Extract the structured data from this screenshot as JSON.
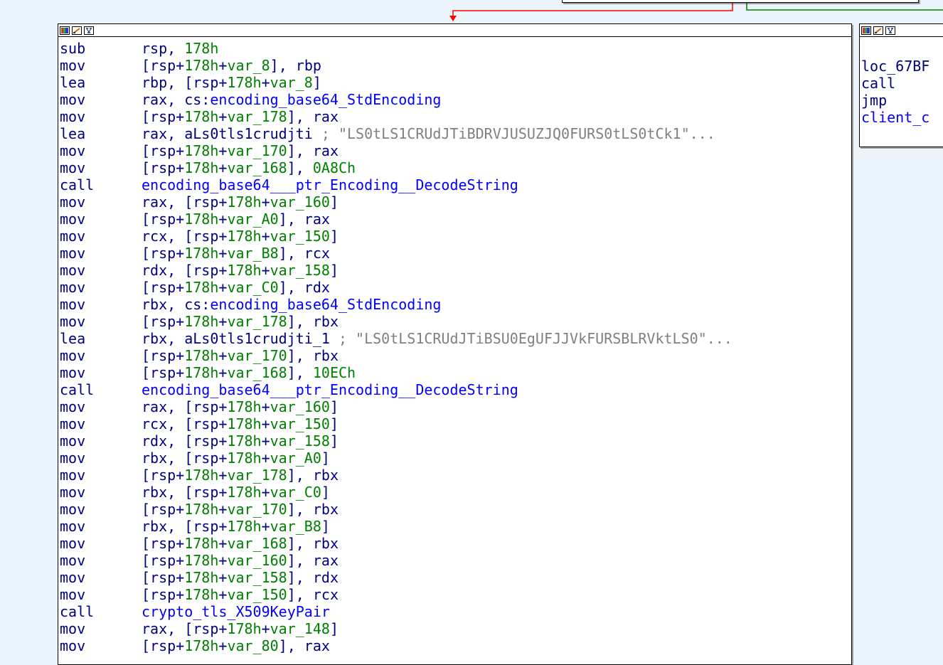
{
  "colors": {
    "background": "#ebf4fb",
    "mnemonic": "#000080",
    "register": "#000080",
    "variable": "#008000",
    "function": "#0000ff",
    "comment": "#808080",
    "edge_taken": "#ff0000",
    "edge_fallthrough": "#008000"
  },
  "main_node": {
    "title_icons": [
      "color-palette-icon",
      "edit-node-icon",
      "graph-overview-icon"
    ],
    "lines": [
      {
        "m": "sub",
        "o": [
          {
            "t": "rsp, ",
            "c": "reg"
          },
          {
            "t": "178h",
            "c": "num"
          }
        ]
      },
      {
        "m": "mov",
        "o": [
          {
            "t": "[rsp+",
            "c": "reg"
          },
          {
            "t": "178h",
            "c": "num"
          },
          {
            "t": "+",
            "c": "reg"
          },
          {
            "t": "var_8",
            "c": "var"
          },
          {
            "t": "], rbp",
            "c": "reg"
          }
        ]
      },
      {
        "m": "lea",
        "o": [
          {
            "t": "rbp, [rsp+",
            "c": "reg"
          },
          {
            "t": "178h",
            "c": "num"
          },
          {
            "t": "+",
            "c": "reg"
          },
          {
            "t": "var_8",
            "c": "var"
          },
          {
            "t": "]",
            "c": "reg"
          }
        ]
      },
      {
        "m": "mov",
        "o": [
          {
            "t": "rax, cs:",
            "c": "reg"
          },
          {
            "t": "encoding_base64_StdEncoding",
            "c": "fn"
          }
        ]
      },
      {
        "m": "mov",
        "o": [
          {
            "t": "[rsp+",
            "c": "reg"
          },
          {
            "t": "178h",
            "c": "num"
          },
          {
            "t": "+",
            "c": "reg"
          },
          {
            "t": "var_178",
            "c": "var"
          },
          {
            "t": "], rax",
            "c": "reg"
          }
        ]
      },
      {
        "m": "lea",
        "o": [
          {
            "t": "rax, aLs0tls1crudjti ",
            "c": "reg"
          },
          {
            "t": "; \"LS0tLS1CRUdJTiBDRVJUSUZJQ0FURS0tLS0tCk1\"...",
            "c": "cmt"
          }
        ]
      },
      {
        "m": "mov",
        "o": [
          {
            "t": "[rsp+",
            "c": "reg"
          },
          {
            "t": "178h",
            "c": "num"
          },
          {
            "t": "+",
            "c": "reg"
          },
          {
            "t": "var_170",
            "c": "var"
          },
          {
            "t": "], rax",
            "c": "reg"
          }
        ]
      },
      {
        "m": "mov",
        "o": [
          {
            "t": "[rsp+",
            "c": "reg"
          },
          {
            "t": "178h",
            "c": "num"
          },
          {
            "t": "+",
            "c": "reg"
          },
          {
            "t": "var_168",
            "c": "var"
          },
          {
            "t": "], ",
            "c": "reg"
          },
          {
            "t": "0A8Ch",
            "c": "num"
          }
        ]
      },
      {
        "m": "call",
        "o": [
          {
            "t": "encoding_base64___ptr_Encoding__DecodeString",
            "c": "fn"
          }
        ]
      },
      {
        "m": "mov",
        "o": [
          {
            "t": "rax, [rsp+",
            "c": "reg"
          },
          {
            "t": "178h",
            "c": "num"
          },
          {
            "t": "+",
            "c": "reg"
          },
          {
            "t": "var_160",
            "c": "var"
          },
          {
            "t": "]",
            "c": "reg"
          }
        ]
      },
      {
        "m": "mov",
        "o": [
          {
            "t": "[rsp+",
            "c": "reg"
          },
          {
            "t": "178h",
            "c": "num"
          },
          {
            "t": "+",
            "c": "reg"
          },
          {
            "t": "var_A0",
            "c": "var"
          },
          {
            "t": "], rax",
            "c": "reg"
          }
        ]
      },
      {
        "m": "mov",
        "o": [
          {
            "t": "rcx, [rsp+",
            "c": "reg"
          },
          {
            "t": "178h",
            "c": "num"
          },
          {
            "t": "+",
            "c": "reg"
          },
          {
            "t": "var_150",
            "c": "var"
          },
          {
            "t": "]",
            "c": "reg"
          }
        ]
      },
      {
        "m": "mov",
        "o": [
          {
            "t": "[rsp+",
            "c": "reg"
          },
          {
            "t": "178h",
            "c": "num"
          },
          {
            "t": "+",
            "c": "reg"
          },
          {
            "t": "var_B8",
            "c": "var"
          },
          {
            "t": "], rcx",
            "c": "reg"
          }
        ]
      },
      {
        "m": "mov",
        "o": [
          {
            "t": "rdx, [rsp+",
            "c": "reg"
          },
          {
            "t": "178h",
            "c": "num"
          },
          {
            "t": "+",
            "c": "reg"
          },
          {
            "t": "var_158",
            "c": "var"
          },
          {
            "t": "]",
            "c": "reg"
          }
        ]
      },
      {
        "m": "mov",
        "o": [
          {
            "t": "[rsp+",
            "c": "reg"
          },
          {
            "t": "178h",
            "c": "num"
          },
          {
            "t": "+",
            "c": "reg"
          },
          {
            "t": "var_C0",
            "c": "var"
          },
          {
            "t": "], rdx",
            "c": "reg"
          }
        ]
      },
      {
        "m": "mov",
        "o": [
          {
            "t": "rbx, cs:",
            "c": "reg"
          },
          {
            "t": "encoding_base64_StdEncoding",
            "c": "fn"
          }
        ]
      },
      {
        "m": "mov",
        "o": [
          {
            "t": "[rsp+",
            "c": "reg"
          },
          {
            "t": "178h",
            "c": "num"
          },
          {
            "t": "+",
            "c": "reg"
          },
          {
            "t": "var_178",
            "c": "var"
          },
          {
            "t": "], rbx",
            "c": "reg"
          }
        ]
      },
      {
        "m": "lea",
        "o": [
          {
            "t": "rbx, aLs0tls1crudjti_1 ",
            "c": "reg"
          },
          {
            "t": "; \"LS0tLS1CRUdJTiBSU0EgUFJJVkFURSBLRVktLS0\"...",
            "c": "cmt"
          }
        ]
      },
      {
        "m": "mov",
        "o": [
          {
            "t": "[rsp+",
            "c": "reg"
          },
          {
            "t": "178h",
            "c": "num"
          },
          {
            "t": "+",
            "c": "reg"
          },
          {
            "t": "var_170",
            "c": "var"
          },
          {
            "t": "], rbx",
            "c": "reg"
          }
        ]
      },
      {
        "m": "mov",
        "o": [
          {
            "t": "[rsp+",
            "c": "reg"
          },
          {
            "t": "178h",
            "c": "num"
          },
          {
            "t": "+",
            "c": "reg"
          },
          {
            "t": "var_168",
            "c": "var"
          },
          {
            "t": "], ",
            "c": "reg"
          },
          {
            "t": "10ECh",
            "c": "num"
          }
        ]
      },
      {
        "m": "call",
        "o": [
          {
            "t": "encoding_base64___ptr_Encoding__DecodeString",
            "c": "fn"
          }
        ]
      },
      {
        "m": "mov",
        "o": [
          {
            "t": "rax, [rsp+",
            "c": "reg"
          },
          {
            "t": "178h",
            "c": "num"
          },
          {
            "t": "+",
            "c": "reg"
          },
          {
            "t": "var_160",
            "c": "var"
          },
          {
            "t": "]",
            "c": "reg"
          }
        ]
      },
      {
        "m": "mov",
        "o": [
          {
            "t": "rcx, [rsp+",
            "c": "reg"
          },
          {
            "t": "178h",
            "c": "num"
          },
          {
            "t": "+",
            "c": "reg"
          },
          {
            "t": "var_150",
            "c": "var"
          },
          {
            "t": "]",
            "c": "reg"
          }
        ]
      },
      {
        "m": "mov",
        "o": [
          {
            "t": "rdx, [rsp+",
            "c": "reg"
          },
          {
            "t": "178h",
            "c": "num"
          },
          {
            "t": "+",
            "c": "reg"
          },
          {
            "t": "var_158",
            "c": "var"
          },
          {
            "t": "]",
            "c": "reg"
          }
        ]
      },
      {
        "m": "mov",
        "o": [
          {
            "t": "rbx, [rsp+",
            "c": "reg"
          },
          {
            "t": "178h",
            "c": "num"
          },
          {
            "t": "+",
            "c": "reg"
          },
          {
            "t": "var_A0",
            "c": "var"
          },
          {
            "t": "]",
            "c": "reg"
          }
        ]
      },
      {
        "m": "mov",
        "o": [
          {
            "t": "[rsp+",
            "c": "reg"
          },
          {
            "t": "178h",
            "c": "num"
          },
          {
            "t": "+",
            "c": "reg"
          },
          {
            "t": "var_178",
            "c": "var"
          },
          {
            "t": "], rbx",
            "c": "reg"
          }
        ]
      },
      {
        "m": "mov",
        "o": [
          {
            "t": "rbx, [rsp+",
            "c": "reg"
          },
          {
            "t": "178h",
            "c": "num"
          },
          {
            "t": "+",
            "c": "reg"
          },
          {
            "t": "var_C0",
            "c": "var"
          },
          {
            "t": "]",
            "c": "reg"
          }
        ]
      },
      {
        "m": "mov",
        "o": [
          {
            "t": "[rsp+",
            "c": "reg"
          },
          {
            "t": "178h",
            "c": "num"
          },
          {
            "t": "+",
            "c": "reg"
          },
          {
            "t": "var_170",
            "c": "var"
          },
          {
            "t": "], rbx",
            "c": "reg"
          }
        ]
      },
      {
        "m": "mov",
        "o": [
          {
            "t": "rbx, [rsp+",
            "c": "reg"
          },
          {
            "t": "178h",
            "c": "num"
          },
          {
            "t": "+",
            "c": "reg"
          },
          {
            "t": "var_B8",
            "c": "var"
          },
          {
            "t": "]",
            "c": "reg"
          }
        ]
      },
      {
        "m": "mov",
        "o": [
          {
            "t": "[rsp+",
            "c": "reg"
          },
          {
            "t": "178h",
            "c": "num"
          },
          {
            "t": "+",
            "c": "reg"
          },
          {
            "t": "var_168",
            "c": "var"
          },
          {
            "t": "], rbx",
            "c": "reg"
          }
        ]
      },
      {
        "m": "mov",
        "o": [
          {
            "t": "[rsp+",
            "c": "reg"
          },
          {
            "t": "178h",
            "c": "num"
          },
          {
            "t": "+",
            "c": "reg"
          },
          {
            "t": "var_160",
            "c": "var"
          },
          {
            "t": "], rax",
            "c": "reg"
          }
        ]
      },
      {
        "m": "mov",
        "o": [
          {
            "t": "[rsp+",
            "c": "reg"
          },
          {
            "t": "178h",
            "c": "num"
          },
          {
            "t": "+",
            "c": "reg"
          },
          {
            "t": "var_158",
            "c": "var"
          },
          {
            "t": "], rdx",
            "c": "reg"
          }
        ]
      },
      {
        "m": "mov",
        "o": [
          {
            "t": "[rsp+",
            "c": "reg"
          },
          {
            "t": "178h",
            "c": "num"
          },
          {
            "t": "+",
            "c": "reg"
          },
          {
            "t": "var_150",
            "c": "var"
          },
          {
            "t": "], rcx",
            "c": "reg"
          }
        ]
      },
      {
        "m": "call",
        "o": [
          {
            "t": "crypto_tls_X509KeyPair",
            "c": "fn"
          }
        ]
      },
      {
        "m": "mov",
        "o": [
          {
            "t": "rax, [rsp+",
            "c": "reg"
          },
          {
            "t": "178h",
            "c": "num"
          },
          {
            "t": "+",
            "c": "reg"
          },
          {
            "t": "var_148",
            "c": "var"
          },
          {
            "t": "]",
            "c": "reg"
          }
        ]
      },
      {
        "m": "mov",
        "o": [
          {
            "t": "[rsp+",
            "c": "reg"
          },
          {
            "t": "178h",
            "c": "num"
          },
          {
            "t": "+",
            "c": "reg"
          },
          {
            "t": "var_80",
            "c": "var"
          },
          {
            "t": "], rax",
            "c": "reg"
          }
        ]
      }
    ]
  },
  "side_node": {
    "title_icons": [
      "color-palette-icon",
      "edit-node-icon",
      "graph-overview-icon"
    ],
    "lines": [
      {
        "m": "loc_67BF",
        "o": []
      },
      {
        "m": "call",
        "o": []
      },
      {
        "m": "jmp",
        "o": []
      },
      {
        "m": "client_c",
        "o": [],
        "cls": "fn"
      }
    ]
  }
}
